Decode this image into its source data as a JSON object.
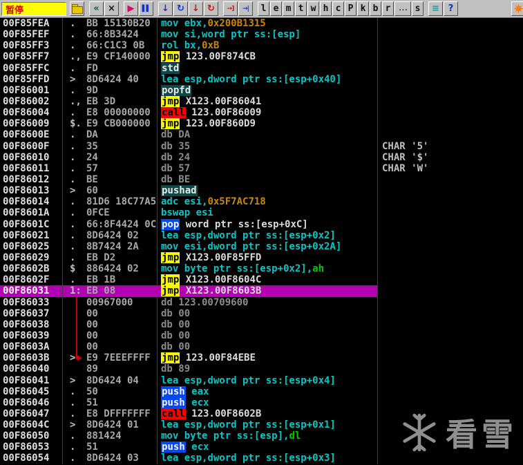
{
  "toolbar": {
    "status": "暂停",
    "buttons": [
      {
        "name": "open-file-button",
        "icon": "folder-icon",
        "kind": "folder"
      },
      {
        "name": "restart-button",
        "icon": "restart-icon",
        "glyph": "«",
        "color": "#00595B",
        "gap": true
      },
      {
        "name": "close-button",
        "icon": "close-icon",
        "glyph": "×",
        "color": "#111111"
      },
      {
        "name": "run-button",
        "icon": "play-icon",
        "glyph": "▶",
        "color": "#E0006A",
        "gap": true
      },
      {
        "name": "pause-button",
        "icon": "pause-icon",
        "glyph": "▌▌",
        "color": "#1133CC"
      },
      {
        "name": "step-into-button",
        "icon": "step-into-icon",
        "glyph": "↓",
        "color": "#1133CC",
        "gap": true
      },
      {
        "name": "step-over-button",
        "icon": "step-over-icon",
        "glyph": "↻",
        "color": "#1133CC"
      },
      {
        "name": "animate-into-button",
        "icon": "animate-into-icon",
        "glyph": "↓",
        "color": "#CC1111"
      },
      {
        "name": "animate-over-button",
        "icon": "animate-over-icon",
        "glyph": "↻",
        "color": "#CC1111"
      },
      {
        "name": "exec-till-return-button",
        "icon": "return-icon",
        "glyph": "→]",
        "color": "#CC1111",
        "gap": true
      },
      {
        "name": "goto-button",
        "icon": "goto-icon",
        "glyph": "→|",
        "color": "#1133CC"
      }
    ],
    "letters": [
      {
        "label": "l",
        "name": "log-pane-button"
      },
      {
        "label": "e",
        "name": "executables-pane-button"
      },
      {
        "label": "m",
        "name": "memory-pane-button"
      },
      {
        "label": "t",
        "name": "threads-pane-button"
      },
      {
        "label": "w",
        "name": "windows-pane-button"
      },
      {
        "label": "h",
        "name": "handles-pane-button"
      },
      {
        "label": "c",
        "name": "cpu-pane-button"
      },
      {
        "label": "P",
        "name": "patches-pane-button"
      },
      {
        "label": "k",
        "name": "call-stack-pane-button"
      },
      {
        "label": "b",
        "name": "breakpoints-pane-button"
      },
      {
        "label": "r",
        "name": "references-pane-button"
      },
      {
        "label": "...",
        "name": "run-trace-pane-button"
      },
      {
        "label": "s",
        "name": "source-pane-button"
      }
    ],
    "tail_buttons": [
      {
        "name": "appearance-button",
        "icon": "list-icon",
        "glyph": "≡",
        "color": "#00A0A8",
        "gap": true
      },
      {
        "name": "help-button",
        "icon": "help-icon",
        "glyph": "?",
        "color": "#1133CC"
      }
    ],
    "right_buttons": [
      {
        "name": "plugin-button",
        "icon": "starburst-icon",
        "kind": "star"
      }
    ]
  },
  "watermark": {
    "text": "看雪"
  },
  "colors": {
    "row_highlight": "#B400B4",
    "jump_badge": "#F8F800",
    "call_badge": "#F80000",
    "stack_badge": "#0048F8",
    "rare_badge": "#104848",
    "jump_line": "#D00000",
    "status_bg": "#FFFF00",
    "status_text": "#E00000"
  },
  "listing": {
    "rows": [
      {
        "addr": "00F85FEA",
        "marks": ".",
        "hex": "BB 15130B20",
        "tokens": [
          {
            "t": "mov ebx,",
            "c": "ins"
          },
          {
            "t": "0x200B1315",
            "c": "imm"
          }
        ]
      },
      {
        "addr": "00F85FEF",
        "marks": ".",
        "hex": "66:8B3424",
        "tokens": [
          {
            "t": "mov si,word ptr ss:[esp]",
            "c": "ins"
          }
        ]
      },
      {
        "addr": "00F85FF3",
        "marks": ".",
        "hex": "66:C1C3 0B",
        "tokens": [
          {
            "t": "rol bx,",
            "c": "ins"
          },
          {
            "t": "0xB",
            "c": "imm"
          }
        ]
      },
      {
        "addr": "00F85FF7",
        "marks": ".,",
        "hex": "E9 CF140000",
        "tokens": [
          {
            "t": "jmp",
            "c": "jmp"
          },
          {
            "t": " 123.00F874CB",
            "c": "tgt"
          }
        ]
      },
      {
        "addr": "00F85FFC",
        "marks": ".",
        "hex": "FD",
        "tokens": [
          {
            "t": "std",
            "c": "rare"
          }
        ]
      },
      {
        "addr": "00F85FFD",
        "marks": ">",
        "hex": "8D6424 40",
        "tokens": [
          {
            "t": "lea esp,dword ptr ss:[esp+0x40]",
            "c": "ins"
          }
        ]
      },
      {
        "addr": "00F86001",
        "marks": ".",
        "hex": "9D",
        "tokens": [
          {
            "t": "popfd",
            "c": "rare"
          }
        ]
      },
      {
        "addr": "00F86002",
        "marks": ".,",
        "hex": "EB 3D",
        "tokens": [
          {
            "t": "jmp",
            "c": "jmp"
          },
          {
            "t": " X123.00F86041",
            "c": "tgt"
          }
        ]
      },
      {
        "addr": "00F86004",
        "marks": ".",
        "hex": "E8 00000000",
        "tokens": [
          {
            "t": "call",
            "c": "call"
          },
          {
            "t": " 123.00F86009",
            "c": "tgt"
          }
        ]
      },
      {
        "addr": "00F86009",
        "marks": "$.",
        "hex": "E9 CB000000",
        "tokens": [
          {
            "t": "jmp",
            "c": "jmp"
          },
          {
            "t": " 123.00F860D9",
            "c": "tgt"
          }
        ]
      },
      {
        "addr": "00F8600E",
        "marks": ".",
        "hex": "DA",
        "tokens": [
          {
            "t": "db DA",
            "c": "raw"
          }
        ]
      },
      {
        "addr": "00F8600F",
        "marks": ".",
        "hex": "35",
        "tokens": [
          {
            "t": "db 35",
            "c": "raw"
          }
        ],
        "comment": "CHAR '5'"
      },
      {
        "addr": "00F86010",
        "marks": ".",
        "hex": "24",
        "tokens": [
          {
            "t": "db 24",
            "c": "raw"
          }
        ],
        "comment": "CHAR '$'"
      },
      {
        "addr": "00F86011",
        "marks": ".",
        "hex": "57",
        "tokens": [
          {
            "t": "db 57",
            "c": "raw"
          }
        ],
        "comment": "CHAR 'W'"
      },
      {
        "addr": "00F86012",
        "marks": ".",
        "hex": "BE",
        "tokens": [
          {
            "t": "db BE",
            "c": "raw"
          }
        ]
      },
      {
        "addr": "00F86013",
        "marks": ">",
        "hex": "60",
        "tokens": [
          {
            "t": "pushad",
            "c": "rare"
          }
        ]
      },
      {
        "addr": "00F86014",
        "marks": ".",
        "hex": "81D6 18C77A5F",
        "tokens": [
          {
            "t": "adc esi,",
            "c": "ins"
          },
          {
            "t": "0x5F7AC718",
            "c": "imm"
          }
        ]
      },
      {
        "addr": "00F8601A",
        "marks": ".",
        "hex": "0FCE",
        "tokens": [
          {
            "t": "bswap esi",
            "c": "ins"
          }
        ]
      },
      {
        "addr": "00F8601C",
        "marks": ".",
        "hex": "66:8F4424 0C",
        "tokens": [
          {
            "t": "pop",
            "c": "push"
          },
          {
            "t": " word ptr ss:[esp+0xC]",
            "c": "tgt"
          }
        ]
      },
      {
        "addr": "00F86021",
        "marks": ".",
        "hex": "8D6424 02",
        "tokens": [
          {
            "t": "lea esp,dword ptr ss:[esp+0x2]",
            "c": "ins"
          }
        ]
      },
      {
        "addr": "00F86025",
        "marks": ".",
        "hex": "8B7424 2A",
        "tokens": [
          {
            "t": "mov esi,dword ptr ss:[esp+0x2A]",
            "c": "ins"
          }
        ]
      },
      {
        "addr": "00F86029",
        "marks": ".",
        "hex": "EB D2",
        "tokens": [
          {
            "t": "jmp",
            "c": "jmp"
          },
          {
            "t": " X123.00F85FFD",
            "c": "tgt"
          }
        ]
      },
      {
        "addr": "00F8602B",
        "marks": "$",
        "hex": "886424 02",
        "tokens": [
          {
            "t": "mov byte ptr ss:[esp+0x2],",
            "c": "ins"
          },
          {
            "t": "ah",
            "c": "reg"
          }
        ]
      },
      {
        "addr": "00F8602F",
        "marks": ".",
        "hex": "EB 1B",
        "tokens": [
          {
            "t": "jmp",
            "c": "jmp"
          },
          {
            "t": " X123.00F8604C",
            "c": "tgt"
          }
        ]
      },
      {
        "addr": "00F86031",
        "marks": "1:",
        "hex": "EB 08",
        "hl": true,
        "tokens": [
          {
            "t": "jmp",
            "c": "jmp"
          },
          {
            "t": " X123.00F8603B",
            "c": "tgt"
          }
        ]
      },
      {
        "addr": "00F86033",
        "marks": "",
        "hex": "00967000",
        "tokens": [
          {
            "t": "dd 123.00709600",
            "c": "raw"
          }
        ]
      },
      {
        "addr": "00F86037",
        "marks": "",
        "hex": "00",
        "tokens": [
          {
            "t": "db 00",
            "c": "raw"
          }
        ]
      },
      {
        "addr": "00F86038",
        "marks": "",
        "hex": "00",
        "tokens": [
          {
            "t": "db 00",
            "c": "raw"
          }
        ]
      },
      {
        "addr": "00F86039",
        "marks": "",
        "hex": "00",
        "tokens": [
          {
            "t": "db 00",
            "c": "raw"
          }
        ]
      },
      {
        "addr": "00F8603A",
        "marks": "",
        "hex": "00",
        "tokens": [
          {
            "t": "db 00",
            "c": "raw"
          }
        ]
      },
      {
        "addr": "00F8603B",
        "marks": ">",
        "hex": "E9 7EEEFFFF",
        "tokens": [
          {
            "t": "jmp",
            "c": "jmp"
          },
          {
            "t": " 123.00F84EBE",
            "c": "tgt"
          }
        ]
      },
      {
        "addr": "00F86040",
        "marks": "",
        "hex": "89",
        "tokens": [
          {
            "t": "db 89",
            "c": "raw"
          }
        ]
      },
      {
        "addr": "00F86041",
        "marks": ">",
        "hex": "8D6424 04",
        "tokens": [
          {
            "t": "lea esp,dword ptr ss:[esp+0x4]",
            "c": "ins"
          }
        ]
      },
      {
        "addr": "00F86045",
        "marks": ".",
        "hex": "50",
        "tokens": [
          {
            "t": "push",
            "c": "push"
          },
          {
            "t": " eax",
            "c": "ins"
          }
        ]
      },
      {
        "addr": "00F86046",
        "marks": ".",
        "hex": "51",
        "tokens": [
          {
            "t": "push",
            "c": "push"
          },
          {
            "t": " ecx",
            "c": "ins"
          }
        ]
      },
      {
        "addr": "00F86047",
        "marks": ".",
        "hex": "E8 DFFFFFFF",
        "tokens": [
          {
            "t": "call",
            "c": "call"
          },
          {
            "t": " 123.00F8602B",
            "c": "tgt"
          }
        ]
      },
      {
        "addr": "00F8604C",
        "marks": ">",
        "hex": "8D6424 01",
        "tokens": [
          {
            "t": "lea esp,dword ptr ss:[esp+0x1]",
            "c": "ins"
          }
        ]
      },
      {
        "addr": "00F86050",
        "marks": ".",
        "hex": "881424",
        "tokens": [
          {
            "t": "mov byte ptr ss:[esp],",
            "c": "ins"
          },
          {
            "t": "dl",
            "c": "reg"
          }
        ]
      },
      {
        "addr": "00F86053",
        "marks": ".",
        "hex": "51",
        "tokens": [
          {
            "t": "push",
            "c": "push"
          },
          {
            "t": " ecx",
            "c": "ins"
          }
        ]
      },
      {
        "addr": "00F86054",
        "marks": ".",
        "hex": "8D6424 03",
        "tokens": [
          {
            "t": "lea esp,dword ptr ss:[esp+0x3]",
            "c": "ins"
          }
        ]
      }
    ]
  }
}
